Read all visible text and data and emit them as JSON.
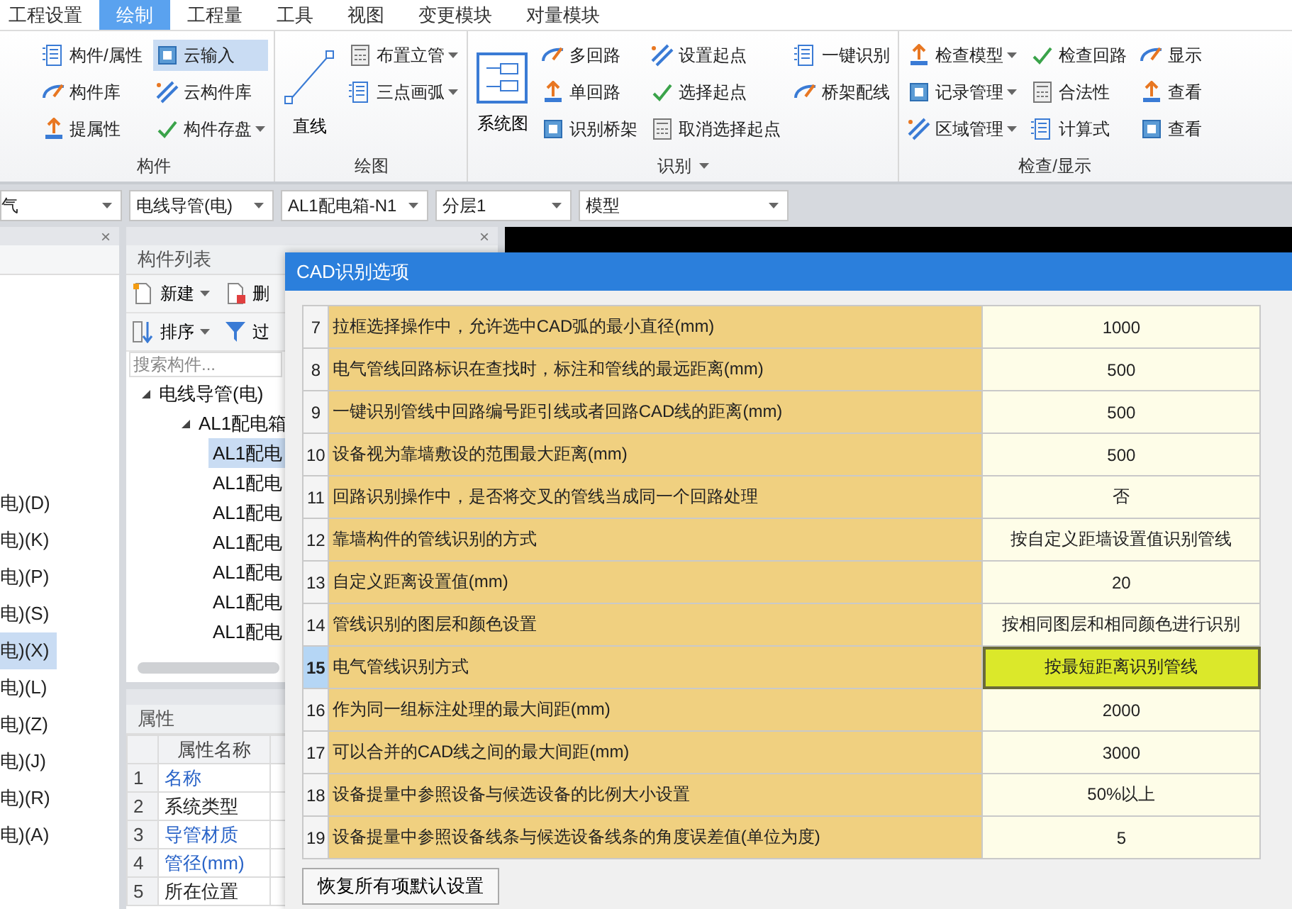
{
  "menu_tabs": [
    {
      "label": "工程设置",
      "selected": false
    },
    {
      "label": "绘制",
      "selected": true
    },
    {
      "label": "工程量",
      "selected": false
    },
    {
      "label": "工具",
      "selected": false
    },
    {
      "label": "视图",
      "selected": false
    },
    {
      "label": "变更模块",
      "selected": false
    },
    {
      "label": "对量模块",
      "selected": false
    }
  ],
  "ribbon": {
    "groups": [
      {
        "label": "构件",
        "caret": false,
        "columns": [
          [
            {
              "label": "构件/属性",
              "caret": false,
              "highlighted": false
            },
            {
              "label": "构件库",
              "caret": false,
              "highlighted": false
            },
            {
              "label": "提属性",
              "caret": false,
              "highlighted": false
            }
          ],
          [
            {
              "label": "云输入",
              "caret": false,
              "highlighted": true
            },
            {
              "label": "云构件库",
              "caret": false,
              "highlighted": false
            },
            {
              "label": "构件存盘",
              "caret": true,
              "highlighted": false
            }
          ]
        ]
      },
      {
        "label": "绘图",
        "caret": false,
        "large": [
          {
            "label": "直线",
            "kind": "line"
          }
        ],
        "columns": [
          [
            {
              "label": "布置立管",
              "caret": true,
              "highlighted": false
            },
            {
              "label": "三点画弧",
              "caret": true,
              "highlighted": false
            }
          ]
        ]
      },
      {
        "label": "识别",
        "caret": true,
        "large": [
          {
            "label": "系统图",
            "kind": "diagram"
          }
        ],
        "columns": [
          [
            {
              "label": "多回路",
              "caret": false,
              "highlighted": false
            },
            {
              "label": "单回路",
              "caret": false,
              "highlighted": false
            },
            {
              "label": "识别桥架",
              "caret": false,
              "highlighted": false
            }
          ],
          [
            {
              "label": "设置起点",
              "caret": false,
              "highlighted": false
            },
            {
              "label": "选择起点",
              "caret": false,
              "highlighted": false
            },
            {
              "label": "取消选择起点",
              "caret": false,
              "highlighted": false
            }
          ],
          [
            {
              "label": "一键识别",
              "caret": false,
              "highlighted": false
            },
            {
              "label": "桥架配线",
              "caret": false,
              "highlighted": false
            }
          ]
        ]
      },
      {
        "label": "检查/显示",
        "caret": false,
        "columns": [
          [
            {
              "label": "检查模型",
              "caret": true,
              "highlighted": false
            },
            {
              "label": "记录管理",
              "caret": true,
              "highlighted": false
            },
            {
              "label": "区域管理",
              "caret": true,
              "highlighted": false
            }
          ],
          [
            {
              "label": "检查回路",
              "caret": false,
              "highlighted": false
            },
            {
              "label": "合法性",
              "caret": false,
              "highlighted": false
            },
            {
              "label": "计算式",
              "caret": false,
              "highlighted": false
            }
          ],
          [
            {
              "label": "显示",
              "caret": false,
              "highlighted": false
            },
            {
              "label": "查看",
              "caret": false,
              "highlighted": false
            },
            {
              "label": "查看",
              "caret": false,
              "highlighted": false
            }
          ]
        ]
      }
    ]
  },
  "selectors": [
    "气",
    "电线导管(电)",
    "AL1配电箱-N1",
    "分层1",
    "模型"
  ],
  "left_panel": {
    "close": "×",
    "items": [
      {
        "label": "电)(D)",
        "selected": false
      },
      {
        "label": "电)(K)",
        "selected": false
      },
      {
        "label": "电)(P)",
        "selected": false
      },
      {
        "label": "电)(S)",
        "selected": false
      },
      {
        "label": "电)(X)",
        "selected": true
      },
      {
        "label": "电)(L)",
        "selected": false
      },
      {
        "label": "电)(Z)",
        "selected": false
      },
      {
        "label": "电)(J)",
        "selected": false
      },
      {
        "label": "电)(R)",
        "selected": false
      },
      {
        "label": "电)(A)",
        "selected": false
      }
    ]
  },
  "component_list": {
    "close": "×",
    "title": "构件列表",
    "toolbar": [
      {
        "label": "新建",
        "caret": true
      },
      {
        "label": "删",
        "caret": false
      },
      {
        "label": "排序",
        "caret": true
      },
      {
        "label": "过",
        "caret": false
      }
    ],
    "search": {
      "placeholder": "搜索构件..."
    },
    "tree": [
      {
        "label": "电线导管(电)",
        "expanded": true,
        "selected": false,
        "children": [
          {
            "label": "AL1配电箱",
            "expanded": true,
            "selected": false,
            "children": [
              {
                "label": "AL1配电",
                "selected": true
              },
              {
                "label": "AL1配电",
                "selected": false
              },
              {
                "label": "AL1配电",
                "selected": false
              },
              {
                "label": "AL1配电",
                "selected": false
              },
              {
                "label": "AL1配电",
                "selected": false
              },
              {
                "label": "AL1配电",
                "selected": false
              },
              {
                "label": "AL1配电",
                "selected": false
              }
            ]
          }
        ]
      }
    ]
  },
  "properties": {
    "title": "属性",
    "header": "属性名称",
    "rows": [
      {
        "no": "1",
        "name": "名称",
        "link": true
      },
      {
        "no": "2",
        "name": "系统类型",
        "link": false
      },
      {
        "no": "3",
        "name": "导管材质",
        "link": true
      },
      {
        "no": "4",
        "name": "管径(mm)",
        "link": true
      },
      {
        "no": "5",
        "name": "所在位置",
        "link": false
      }
    ]
  },
  "dialog": {
    "title": "CAD识别选项",
    "rows": [
      {
        "no": "7",
        "label": "拉框选择操作中，允许选中CAD弧的最小直径(mm)",
        "value": "1000",
        "selected": false
      },
      {
        "no": "8",
        "label": "电气管线回路标识在查找时，标注和管线的最远距离(mm)",
        "value": "500",
        "selected": false
      },
      {
        "no": "9",
        "label": "一键识别管线中回路编号距引线或者回路CAD线的距离(mm)",
        "value": "500",
        "selected": false
      },
      {
        "no": "10",
        "label": "设备视为靠墙敷设的范围最大距离(mm)",
        "value": "500",
        "selected": false
      },
      {
        "no": "11",
        "label": "回路识别操作中，是否将交叉的管线当成同一个回路处理",
        "value": "否",
        "selected": false
      },
      {
        "no": "12",
        "label": "靠墙构件的管线识别的方式",
        "value": "按自定义距墙设置值识别管线",
        "selected": false
      },
      {
        "no": "13",
        "label": "自定义距离设置值(mm)",
        "value": "20",
        "selected": false
      },
      {
        "no": "14",
        "label": "管线识别的图层和颜色设置",
        "value": "按相同图层和相同颜色进行识别",
        "selected": false
      },
      {
        "no": "15",
        "label": "电气管线识别方式",
        "value": "按最短距离识别管线",
        "selected": true
      },
      {
        "no": "16",
        "label": "作为同一组标注处理的最大间距(mm)",
        "value": "2000",
        "selected": false
      },
      {
        "no": "17",
        "label": "可以合并的CAD线之间的最大间距(mm)",
        "value": "3000",
        "selected": false
      },
      {
        "no": "18",
        "label": "设备提量中参照设备与候选设备的比例大小设置",
        "value": "50%以上",
        "selected": false
      },
      {
        "no": "19",
        "label": "设备提量中参照设备线条与候选设备线条的角度误差值(单位为度)",
        "value": "5",
        "selected": false
      }
    ],
    "reset_button": "恢复所有项默认设置"
  }
}
